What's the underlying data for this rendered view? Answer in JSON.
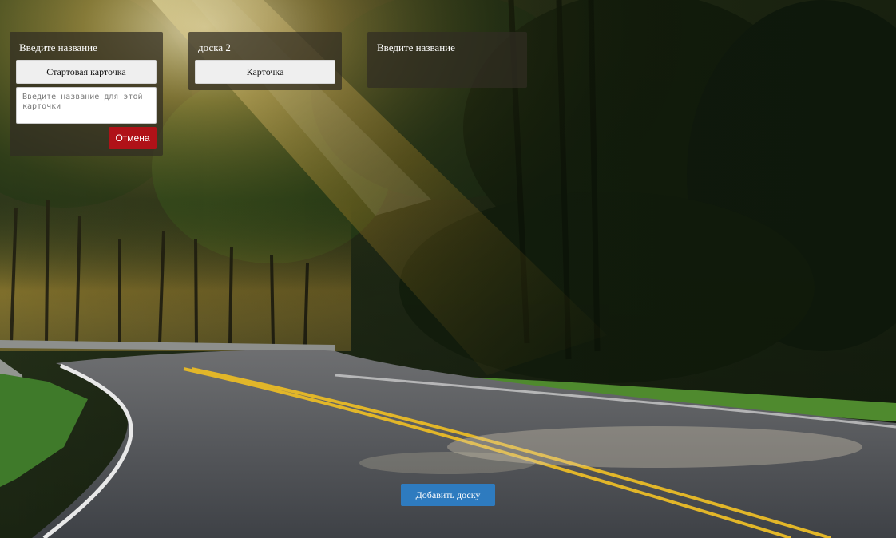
{
  "boards": [
    {
      "title": "Введите название",
      "cards": [
        "Стартовая карточка"
      ],
      "new_card_placeholder": "Введите название для этой карточки",
      "cancel_label": "Отмена"
    },
    {
      "title": "доска 2",
      "cards": [
        "Карточка"
      ]
    },
    {
      "title": "Введите название",
      "cards": []
    }
  ],
  "add_board_label": "Добавить доску",
  "colors": {
    "board_bg": "#302c22",
    "card_bg": "#efefef",
    "cancel_button": "#b01218",
    "add_board_button": "#2e7bbf"
  }
}
